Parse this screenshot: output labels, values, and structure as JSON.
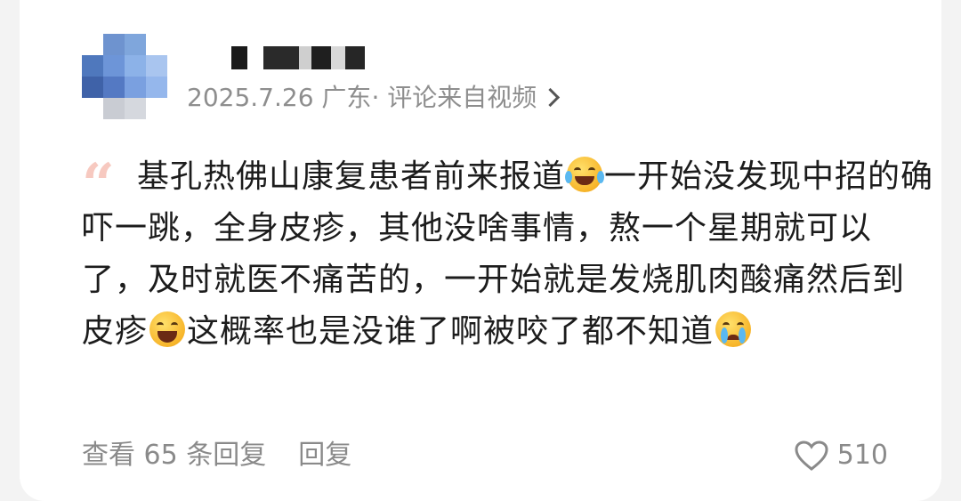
{
  "user": {
    "name_redacted": true
  },
  "meta": {
    "date": "2025.7.26",
    "location": "广东",
    "source": "· 评论来自视频"
  },
  "comment": {
    "seg1": "基孔热佛山康复患者前来报道",
    "emoji1": "laughing-tears-emoji",
    "seg2": "一开始没发现中招的确吓一跳，全身皮疹，其他没啥事情，熬一个星期就可以了，及时就医不痛苦的，一开始就是发烧肌肉酸痛然后到皮疹",
    "emoji2": "big-laugh-emoji",
    "seg3": "这概率也是没谁了啊被咬了都不知道",
    "emoji3": "crying-emoji"
  },
  "footer": {
    "view_replies": "查看 65 条回复",
    "reply": "回复",
    "like_count": "510"
  },
  "colors": {
    "quote": "#f7c9c0",
    "meta_text": "#8e8e8e",
    "body_text": "#1c1c1c",
    "footer_text": "#8a8a8a"
  }
}
